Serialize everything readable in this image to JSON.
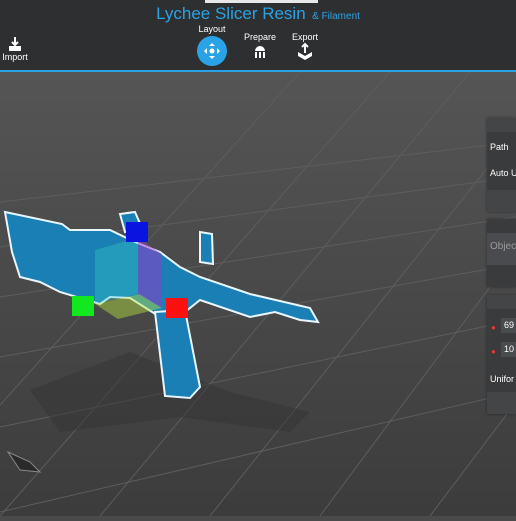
{
  "header": {
    "title_main": "Lychee Slicer Resin",
    "title_sub": "& Filament",
    "accent_color": "#2aa3e6"
  },
  "toolbar": {
    "import_label": "Import",
    "import_icon": "import-icon",
    "tabs": [
      {
        "label": "Layout",
        "icon": "move-arrows-icon",
        "active": true
      },
      {
        "label": "Prepare",
        "icon": "support-icon",
        "active": false
      },
      {
        "label": "Export",
        "icon": "export-icon",
        "active": false
      }
    ]
  },
  "right_panel": {
    "path_label": "Path",
    "auto_label": "Auto U",
    "object_label": "Objec",
    "field1_value": "69",
    "field2_value": "10",
    "uniform_label": "Unifor"
  }
}
